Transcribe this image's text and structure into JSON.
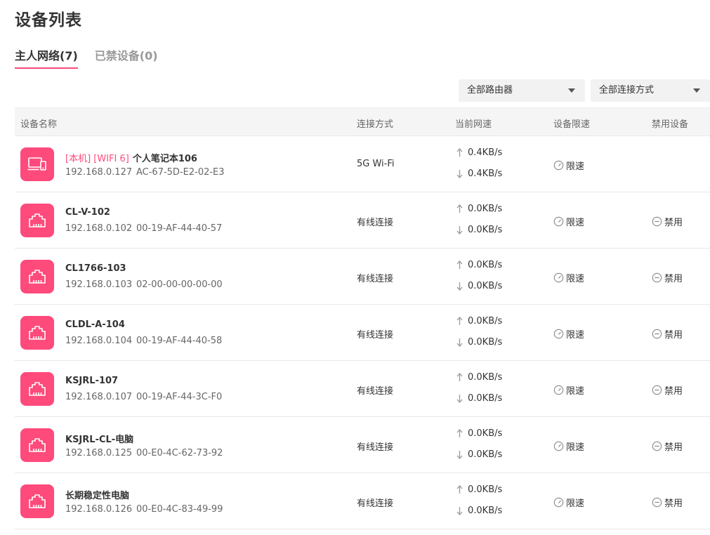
{
  "page_title": "设备列表",
  "tabs": [
    {
      "label": "主人网络(7)",
      "active": true
    },
    {
      "label": "已禁设备(0)",
      "active": false
    }
  ],
  "filters": {
    "router": "全部路由器",
    "connection": "全部连接方式"
  },
  "columns": {
    "name": "设备名称",
    "connection": "连接方式",
    "speed": "当前网速",
    "limit": "设备限速",
    "ban": "禁用设备"
  },
  "actions": {
    "limit_label": "限速",
    "ban_label": "禁用"
  },
  "colors": {
    "accent": "#ff4a7c"
  },
  "devices": [
    {
      "tags": "[本机] [WIFI 6]",
      "name": "个人笔记本106",
      "ip": "192.168.0.127",
      "mac": "AC-67-5D-E2-02-E3",
      "connection": "5G Wi-Fi",
      "up": "0.4KB/s",
      "down": "0.4KB/s",
      "icon": "laptop-phone-icon",
      "can_ban": false
    },
    {
      "tags": "",
      "name": "CL-V-102",
      "ip": "192.168.0.102",
      "mac": "00-19-AF-44-40-57",
      "connection": "有线连接",
      "up": "0.0KB/s",
      "down": "0.0KB/s",
      "icon": "ethernet-port-icon",
      "can_ban": true
    },
    {
      "tags": "",
      "name": "CL1766-103",
      "ip": "192.168.0.103",
      "mac": "02-00-00-00-00-00",
      "connection": "有线连接",
      "up": "0.0KB/s",
      "down": "0.0KB/s",
      "icon": "ethernet-port-icon",
      "can_ban": true
    },
    {
      "tags": "",
      "name": "CLDL-A-104",
      "ip": "192.168.0.104",
      "mac": "00-19-AF-44-40-58",
      "connection": "有线连接",
      "up": "0.0KB/s",
      "down": "0.0KB/s",
      "icon": "ethernet-port-icon",
      "can_ban": true
    },
    {
      "tags": "",
      "name": "KSJRL-107",
      "ip": "192.168.0.107",
      "mac": "00-19-AF-44-3C-F0",
      "connection": "有线连接",
      "up": "0.0KB/s",
      "down": "0.0KB/s",
      "icon": "ethernet-port-icon",
      "can_ban": true
    },
    {
      "tags": "",
      "name": "KSJRL-CL-电脑",
      "ip": "192.168.0.125",
      "mac": "00-E0-4C-62-73-92",
      "connection": "有线连接",
      "up": "0.0KB/s",
      "down": "0.0KB/s",
      "icon": "ethernet-port-icon",
      "can_ban": true
    },
    {
      "tags": "",
      "name": "长期稳定性电脑",
      "ip": "192.168.0.126",
      "mac": "00-E0-4C-83-49-99",
      "connection": "有线连接",
      "up": "0.0KB/s",
      "down": "0.0KB/s",
      "icon": "ethernet-port-icon",
      "can_ban": true
    }
  ]
}
